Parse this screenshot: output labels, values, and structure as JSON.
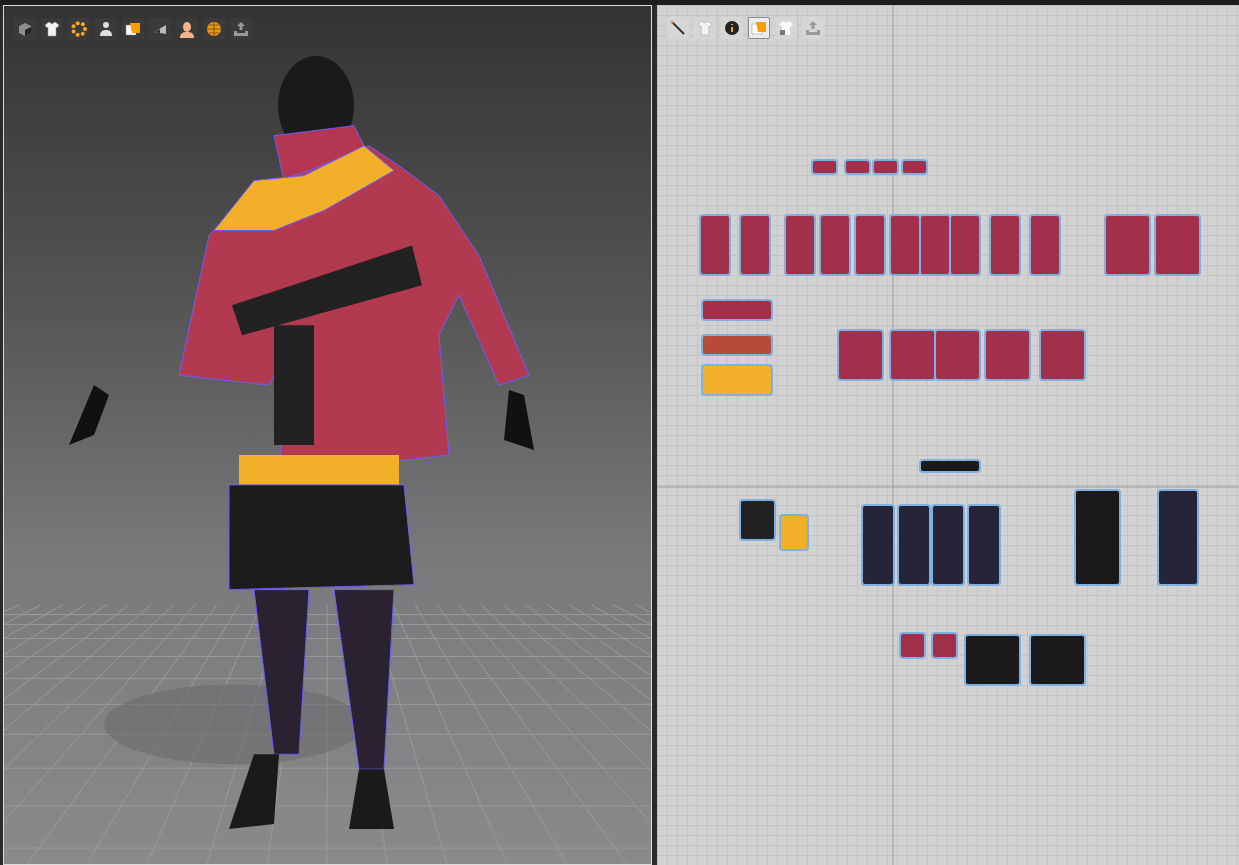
{
  "viewport_3d": {
    "toolbar": [
      {
        "kind": "cube",
        "selected": false
      },
      {
        "kind": "shirt",
        "selected": false
      },
      {
        "kind": "dots",
        "selected": false
      },
      {
        "kind": "avatar",
        "selected": false
      },
      {
        "kind": "sheets",
        "selected": false
      },
      {
        "kind": "wedge",
        "selected": false
      },
      {
        "kind": "head",
        "selected": false
      },
      {
        "kind": "globe",
        "selected": false
      },
      {
        "kind": "export",
        "selected": false
      }
    ]
  },
  "pattern_2d": {
    "toolbar": [
      {
        "kind": "needle",
        "selected": false
      },
      {
        "kind": "shirt",
        "selected": false
      },
      {
        "kind": "info",
        "selected": false
      },
      {
        "kind": "sheets",
        "selected": true
      },
      {
        "kind": "lock-shirt",
        "selected": false
      },
      {
        "kind": "export",
        "selected": false
      }
    ]
  }
}
